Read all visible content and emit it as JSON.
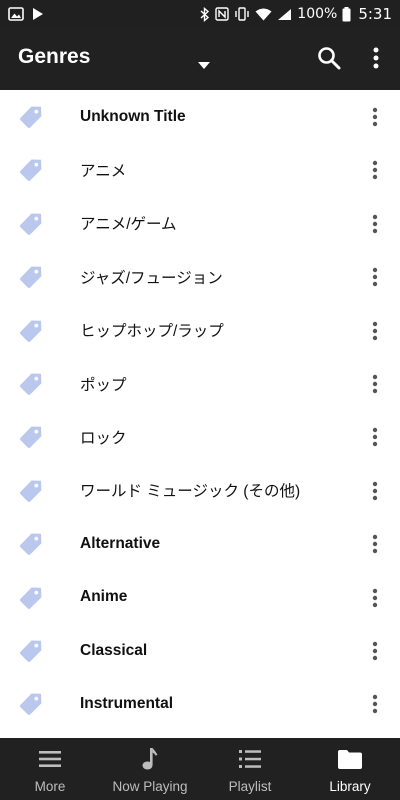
{
  "status_bar": {
    "battery_text": "100%",
    "time": "5:31",
    "left_icons": [
      "image-icon",
      "play-icon"
    ],
    "right_icons": [
      "bluetooth-icon",
      "nfc-icon",
      "vibrate-icon",
      "wifi-icon",
      "signal-icon",
      "battery-icon"
    ]
  },
  "app_bar": {
    "title": "Genres",
    "icons": [
      "dropdown-caret-icon",
      "search-icon",
      "overflow-menu-icon"
    ]
  },
  "colors": {
    "app_bar_bg": "#212121",
    "status_bar_bg": "#202020",
    "tag_icon": "#b9c8ec",
    "nav_active": "#ffffff",
    "nav_inactive": "#bdbdbd"
  },
  "genres": [
    {
      "label": "Unknown Title",
      "bold": true
    },
    {
      "label": "アニメ",
      "bold": false
    },
    {
      "label": "アニメ/ゲーム",
      "bold": false
    },
    {
      "label": "ジャズ/フュージョン",
      "bold": false
    },
    {
      "label": "ヒップホップ/ラップ",
      "bold": false
    },
    {
      "label": "ポップ",
      "bold": false
    },
    {
      "label": "ロック",
      "bold": false
    },
    {
      "label": "ワールド ミュージック (その他)",
      "bold": false
    },
    {
      "label": "Alternative",
      "bold": true
    },
    {
      "label": "Anime",
      "bold": true
    },
    {
      "label": "Classical",
      "bold": true
    },
    {
      "label": "Instrumental",
      "bold": true
    }
  ],
  "bottom_nav": {
    "items": [
      {
        "label": "More",
        "icon": "hamburger-icon",
        "active": false
      },
      {
        "label": "Now Playing",
        "icon": "music-note-icon",
        "active": false
      },
      {
        "label": "Playlist",
        "icon": "playlist-icon",
        "active": false
      },
      {
        "label": "Library",
        "icon": "folder-icon",
        "active": true
      }
    ]
  }
}
